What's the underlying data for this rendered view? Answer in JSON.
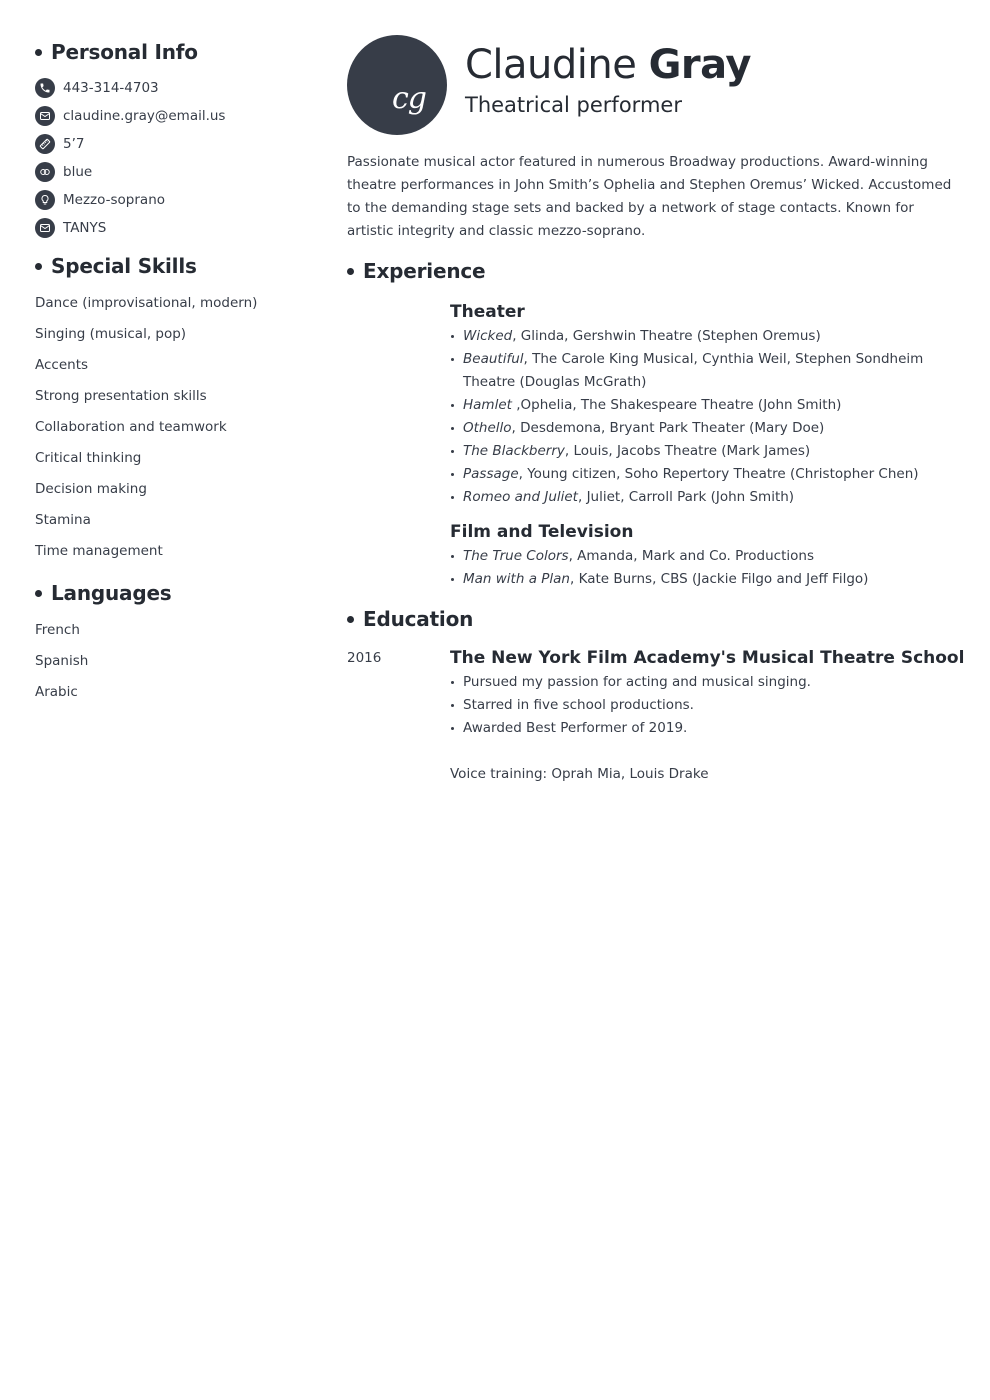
{
  "colors": {
    "primary": "#373d48",
    "heading": "#262b33",
    "background": "#ffffff"
  },
  "personal_info": {
    "heading": "Personal Info",
    "items": [
      {
        "icon": "phone-icon",
        "value": "443-314-4703"
      },
      {
        "icon": "email-icon",
        "value": "claudine.gray@email.us"
      },
      {
        "icon": "ruler-icon",
        "value": "5’7"
      },
      {
        "icon": "eyes-icon",
        "value": "blue"
      },
      {
        "icon": "lightbulb-icon",
        "value": "Mezzo-soprano"
      },
      {
        "icon": "envelope-icon",
        "value": "TANYS"
      }
    ]
  },
  "special_skills": {
    "heading": "Special Skills",
    "items": [
      "Dance (improvisational, modern)",
      "Singing (musical, pop)",
      "Accents",
      "Strong presentation skills",
      "Collaboration and teamwork",
      "Critical thinking",
      "Decision making",
      "Stamina",
      "Time management"
    ]
  },
  "languages": {
    "heading": "Languages",
    "items": [
      "French",
      "Spanish",
      "Arabic"
    ]
  },
  "header": {
    "initials": "cg",
    "first_name": "Claudine",
    "last_name": "Gray",
    "title": "Theatrical performer"
  },
  "summary": "Passionate musical actor featured in numerous Broadway productions. Award-winning theatre performances in John Smith’s Ophelia and Stephen Oremus’ Wicked. Accustomed to the demanding stage sets and backed by a network of stage contacts. Known for artistic integrity and classic mezzo-soprano.",
  "experience": {
    "heading": "Experience",
    "theater": {
      "heading": "Theater",
      "items": [
        {
          "title": "Wicked",
          "rest": ", Glinda, Gershwin Theatre (Stephen Oremus)"
        },
        {
          "title": "Beautiful",
          "rest": ", The Carole King Musical, Cynthia Weil, Stephen Sondheim Theatre (Douglas McGrath)"
        },
        {
          "title": "Hamlet",
          "rest": " ,Ophelia, The Shakespeare Theatre (John Smith)"
        },
        {
          "title": "Othello",
          "rest": ", Desdemona, Bryant Park Theater (Mary Doe)"
        },
        {
          "title": "The Blackberry",
          "rest": ", Louis, Jacobs Theatre (Mark James)"
        },
        {
          "title": "Passage",
          "rest": ", Young citizen, Soho Repertory Theatre (Christopher Chen)"
        },
        {
          "title": "Romeo and Juliet",
          "rest": ", Juliet, Carroll Park (John Smith)"
        }
      ]
    },
    "film": {
      "heading": "Film and Television",
      "items": [
        {
          "title": "The True Colors",
          "rest": ", Amanda, Mark and Co. Productions"
        },
        {
          "title": "Man with a Plan",
          "rest": ", Kate Burns, CBS (Jackie Filgo and Jeff Filgo)"
        }
      ]
    }
  },
  "education": {
    "heading": "Education",
    "year": "2016",
    "school": "The New York Film Academy's Musical Theatre School",
    "bullets": [
      "Pursued my passion for acting and musical singing.",
      "Starred in five school productions.",
      "Awarded Best Performer of 2019."
    ],
    "note": "Voice training: Oprah Mia, Louis Drake"
  }
}
